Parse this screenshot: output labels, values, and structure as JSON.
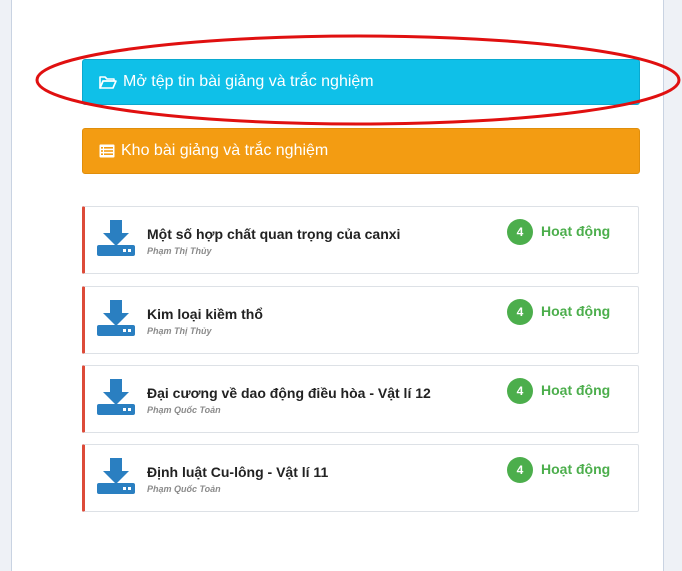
{
  "buttons": {
    "open_label": "Mở tệp tin bài giảng và trắc nghiệm",
    "store_label": "Kho bài giảng và trắc nghiệm"
  },
  "lessons": [
    {
      "title": "Một số hợp chất quan trọng của canxi",
      "author": "Phạm Thị Thủy",
      "count": "4",
      "status": "Hoạt động"
    },
    {
      "title": "Kim loại kiềm thổ",
      "author": "Phạm Thị Thủy",
      "count": "4",
      "status": "Hoạt động"
    },
    {
      "title": "Đại cương về dao động điều hòa - Vật lí 12",
      "author": "Phạm Quốc Toản",
      "count": "4",
      "status": "Hoạt động"
    },
    {
      "title": "Định luật Cu-lông - Vật lí 11",
      "author": "Phạm Quốc Toản",
      "count": "4",
      "status": "Hoạt động"
    }
  ],
  "colors": {
    "open_button": "#0fc0e8",
    "store_button": "#f39c12",
    "card_accent": "#dd4b39",
    "status_green": "#4cae4c",
    "download_icon": "#2a7fc1",
    "highlight_ellipse": "#e01010"
  },
  "icons": {
    "open": "folder-open-icon",
    "store": "list-icon",
    "lesson": "download-icon"
  }
}
